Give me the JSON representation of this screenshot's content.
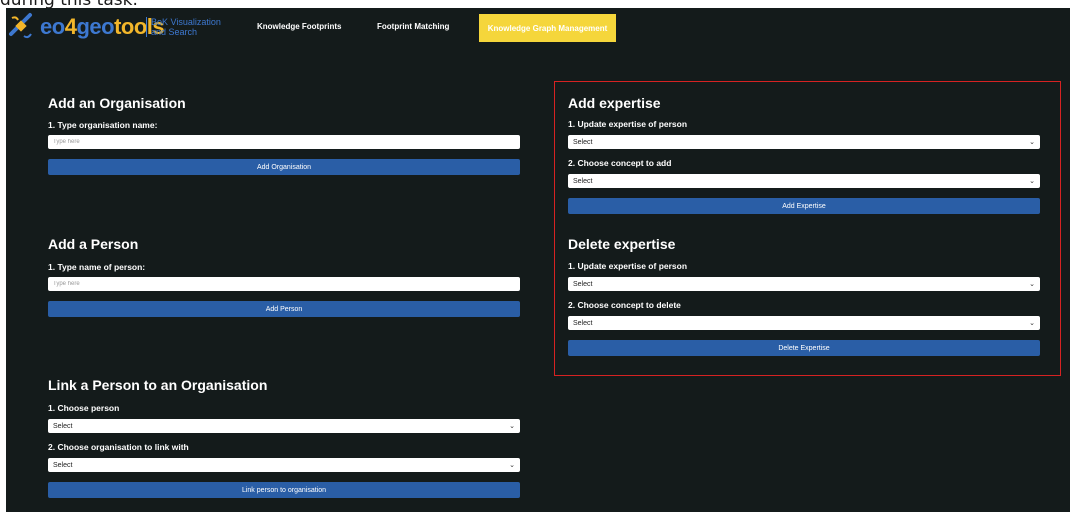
{
  "caption": "during this task.",
  "brand": {
    "logo_eo": "eo",
    "logo_four": "4",
    "logo_geo": "geo",
    "logo_tools": "tools",
    "tagline": "BoK Visualization and Search"
  },
  "nav": {
    "items": [
      {
        "label": "Knowledge Footprints"
      },
      {
        "label": "Footprint Matching"
      },
      {
        "label": "Knowledge Graph Management"
      }
    ]
  },
  "add_org": {
    "title": "Add an Organisation",
    "label": "1. Type organisation name:",
    "placeholder": "Type here",
    "button": "Add Organisation"
  },
  "add_person": {
    "title": "Add a Person",
    "label": "1. Type name of person:",
    "placeholder": "Type here",
    "button": "Add Person"
  },
  "link_person": {
    "title": "Link a Person to an Organisation",
    "label1": "1. Choose person",
    "select1": "Select",
    "label2": "2. Choose organisation to link with",
    "select2": "Select",
    "button": "Link person to organisation"
  },
  "add_expertise": {
    "title": "Add expertise",
    "label1": "1. Update expertise of person",
    "select1": "Select",
    "label2": "2. Choose concept to add",
    "select2": "Select",
    "button": "Add Expertise"
  },
  "delete_expertise": {
    "title": "Delete expertise",
    "label1": "1. Update expertise of person",
    "select1": "Select",
    "label2": "2. Choose concept to delete",
    "select2": "Select",
    "button": "Delete Expertise"
  },
  "colors": {
    "background": "#141b1b",
    "button": "#2a5ea6",
    "active_nav": "#f5d63b",
    "highlight_border": "#d62222",
    "brand_blue": "#3d78d0",
    "brand_yellow": "#f2b62b"
  },
  "icons": {
    "logo": "satellite-icon",
    "dropdown": "chevron-down-icon"
  }
}
